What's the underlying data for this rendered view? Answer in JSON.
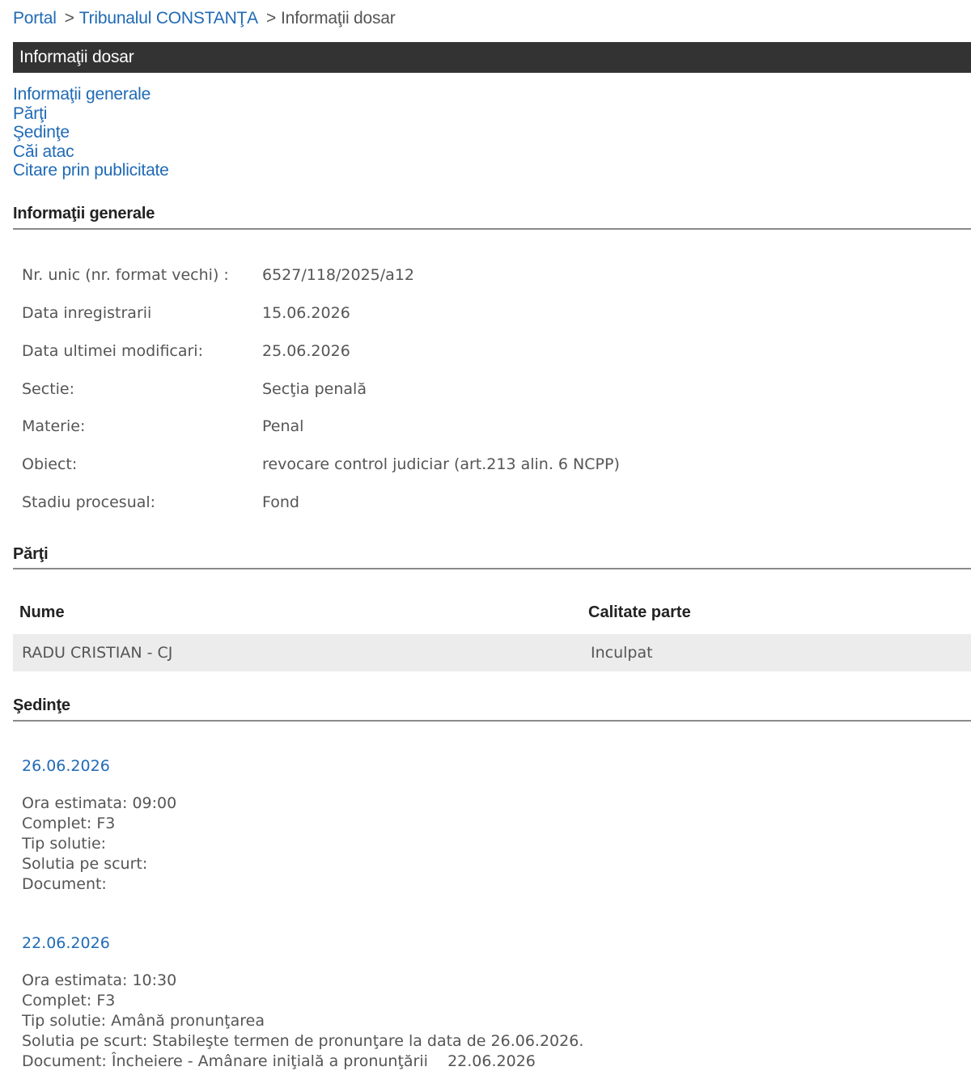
{
  "breadcrumb": {
    "portal": "Portal",
    "separator": ">",
    "court": "Tribunalul CONSTANŢA",
    "current": "Informaţii dosar"
  },
  "header": {
    "title": "Informaţii dosar"
  },
  "nav": {
    "items": [
      "Informaţii generale",
      "Părţi",
      "Şedinţe",
      "Căi atac",
      "Citare prin publicitate"
    ]
  },
  "general": {
    "title": "Informaţii generale",
    "rows": [
      {
        "label": "Nr. unic (nr. format vechi) :",
        "value": "6527/118/2025/a12"
      },
      {
        "label": "Data inregistrarii",
        "value": "15.06.2026"
      },
      {
        "label": "Data ultimei modificari:",
        "value": "25.06.2026"
      },
      {
        "label": "Sectie:",
        "value": "Secţia penală"
      },
      {
        "label": "Materie:",
        "value": "Penal"
      },
      {
        "label": "Obiect:",
        "value": "revocare control judiciar (art.213 alin. 6 NCPP)"
      },
      {
        "label": "Stadiu procesual:",
        "value": "Fond"
      }
    ]
  },
  "parti": {
    "title": "Părţi",
    "col_name": "Nume",
    "col_role": "Calitate parte",
    "rows": [
      {
        "name": "RADU CRISTIAN - CJ",
        "role": "Inculpat"
      }
    ]
  },
  "sedinte": {
    "title": "Şedinţe",
    "items": [
      {
        "date": "26.06.2026",
        "ora": "Ora estimata: 09:00",
        "complet": "Complet: F3",
        "tip": "Tip solutie:",
        "solutia": "Solutia pe scurt:",
        "document": "Document:"
      },
      {
        "date": "22.06.2026",
        "ora": "Ora estimata: 10:30",
        "complet": "Complet: F3",
        "tip": "Tip solutie: Amână pronunţarea",
        "solutia": "Solutia pe scurt: Stabileşte termen de pronunţare la data de 26.06.2026.",
        "document": "Document: Încheiere - Amânare iniţială a pronunţării    22.06.2026"
      }
    ]
  },
  "colors": {
    "link": "#1f6ab5",
    "header_bg": "#333333",
    "row_bg": "#ececec",
    "text": "#555555"
  }
}
